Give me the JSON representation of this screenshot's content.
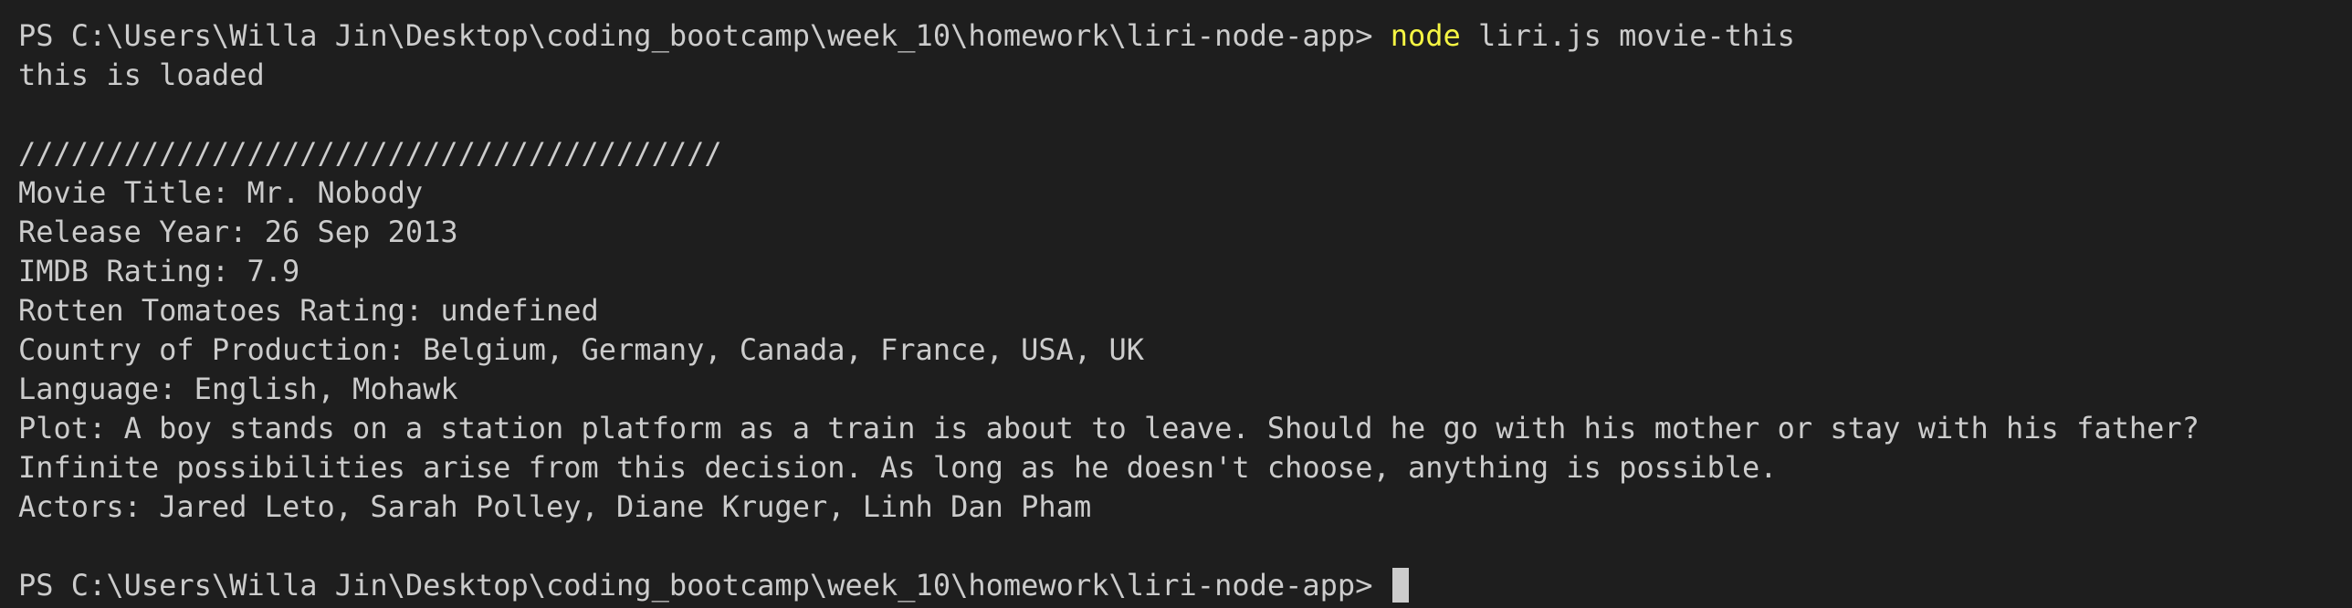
{
  "terminal": {
    "prompt": "PS C:\\Users\\Willa Jin\\Desktop\\coding_bootcamp\\week_10\\homework\\liri-node-app>",
    "command_keyword": "node",
    "command_args": "liri.js movie-this",
    "loaded_message": "this is loaded",
    "separator": "////////////////////////////////////////",
    "movie_lines": [
      "Movie Title: Mr. Nobody",
      "Release Year: 26 Sep 2013",
      "IMDB Rating: 7.9",
      "Rotten Tomatoes Rating: undefined",
      "Country of Production: Belgium, Germany, Canada, France, USA, UK",
      "Language: English, Mohawk",
      "Plot: A boy stands on a station platform as a train is about to leave. Should he go with his mother or stay with his father? Infinite possibilities arise from this decision. As long as he doesn't choose, anything is possible.",
      "Actors: Jared Leto, Sarah Polley, Diane Kruger, Linh Dan Pham"
    ]
  },
  "colors": {
    "background": "#1e1e1e",
    "text": "#cccccc",
    "command_keyword": "#f5f543"
  }
}
